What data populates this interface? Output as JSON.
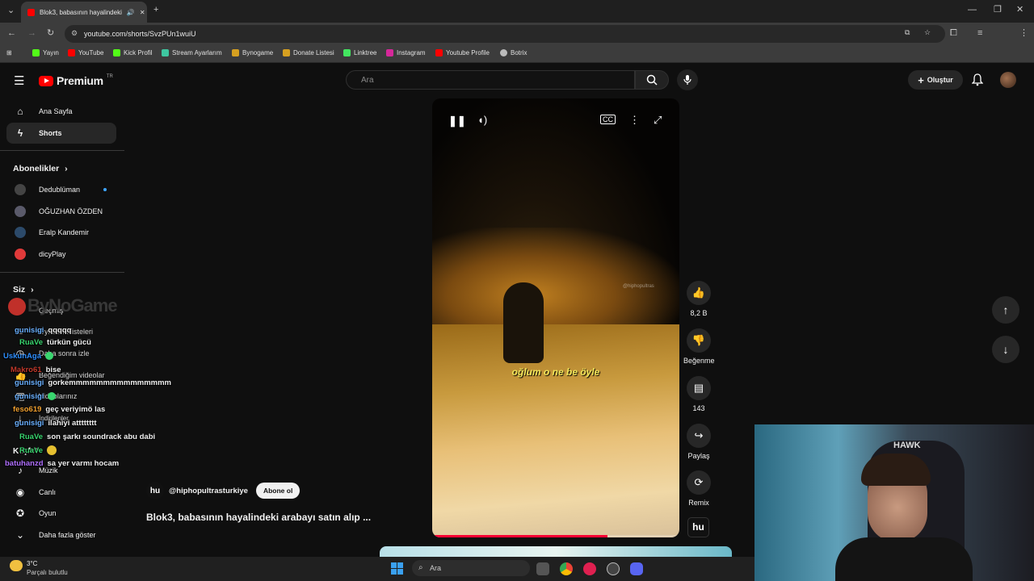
{
  "browser": {
    "tab_title": "Blok3, babasının hayalindeki",
    "url": "youtube.com/shorts/SvzPUn1wuiU",
    "bookmarks": [
      "Yayın",
      "YouTube",
      "Kick Profil",
      "Stream Ayarlarım",
      "Bynogame",
      "Donate Listesi",
      "Linktree",
      "Instagram",
      "Youtube Profile",
      "Botrix"
    ]
  },
  "header": {
    "logo_text": "Premium",
    "logo_sup": "TR",
    "search_placeholder": "Ara",
    "create_label": "Oluştur"
  },
  "sidebar": {
    "main": [
      {
        "label": "Ana Sayfa",
        "icon": "home-icon"
      },
      {
        "label": "Shorts",
        "icon": "shorts-icon"
      }
    ],
    "subs_title": "Abonelikler",
    "subscriptions": [
      "Dedublüman",
      "OĞUZHAN ÖZDEN",
      "Eralp Kandemir",
      "dicyPlay"
    ],
    "you_title": "Siz",
    "you_items": [
      "Geçmiş",
      "Oynatma listeleri",
      "Daha sonra izle",
      "Beğendiğim videolar",
      "Videolarınız",
      "İndirilenler"
    ],
    "explore_title": "Keşfet",
    "explore_items": [
      "Müzik",
      "Canlı",
      "Oyun",
      "Daha fazla göster"
    ]
  },
  "overlay_logo": "ByNoGame",
  "chat": [
    {
      "user": "gunisigi",
      "msg": "qqqqq",
      "color": "#6ab0ff"
    },
    {
      "user": "RuaVe",
      "msg": "türkün gücü",
      "color": "#39d66f"
    },
    {
      "user": "UskunAga",
      "msg": "",
      "color": "#2f8fff"
    },
    {
      "user": "Makro61",
      "msg": "bise",
      "color": "#c0392b"
    },
    {
      "user": "gunisigi",
      "msg": "gorkemmmmmmmmmmmmmmm",
      "color": "#6ab0ff"
    },
    {
      "user": "gunisigi",
      "msg": "",
      "color": "#6ab0ff"
    },
    {
      "user": "feso619",
      "msg": "geç veriyimö las",
      "color": "#f0a030"
    },
    {
      "user": "gunisigi",
      "msg": "ilahiyi atttttttt",
      "color": "#6ab0ff"
    },
    {
      "user": "RuaVe",
      "msg": "son şarkı soundrack abu dabi",
      "color": "#39d66f"
    },
    {
      "user": "RuaVe",
      "msg": "",
      "color": "#39d66f"
    },
    {
      "user": "batuhanzd",
      "msg": "sa yer varmı hocam",
      "color": "#b070ff"
    }
  ],
  "video": {
    "subtitle": "oğlum o ne be öyle",
    "watermark": "@hiphopultras",
    "progress": 0.71
  },
  "actions": {
    "likes": "8,2 B",
    "dislike_label": "Beğenme",
    "comments": "143",
    "share_label": "Paylaş",
    "remix_label": "Remix"
  },
  "channel": {
    "handle": "@hiphopultrasturkiye",
    "subscribe_label": "Abone ol",
    "title": "Blok3, babasının hayalindeki arabayı satın alıp ..."
  },
  "webcam_text": "HAWK",
  "taskbar": {
    "weather_temp": "3°C",
    "weather_desc": "Parçalı bulutlu",
    "search_label": "Ara"
  },
  "colors": {
    "brand": "#ff0000",
    "progress": "#ff0033"
  }
}
